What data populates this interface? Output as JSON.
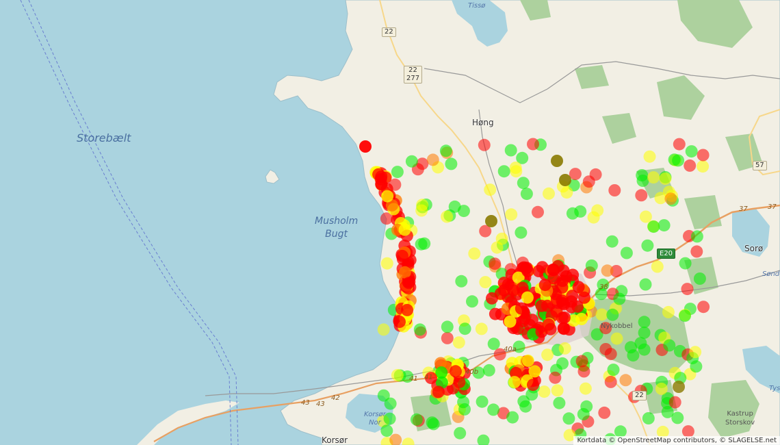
{
  "map": {
    "sea_label": "Storebælt",
    "bay_label_1": "Musholm",
    "bay_label_2": "Bugt",
    "towns": {
      "hong": "Høng",
      "soro": "Sorø",
      "korsor": "Korsør",
      "sonde": "Sønde",
      "tys": "Tys"
    },
    "water": {
      "tisso": "Tissø",
      "korsor_nor_1": "Korsør",
      "korsor_nor_2": "Nor"
    },
    "forests": {
      "nykobbel": "Nykobbel",
      "kastrup_1": "Kastrup",
      "kastrup_2": "Storskov"
    },
    "road_shields": {
      "r22_top": "22",
      "r22_mid": "22",
      "r277": "277",
      "r57": "57",
      "r22_south": "22"
    },
    "e_route": "E20",
    "road_numbers": {
      "n37a": "37",
      "n37b": "37",
      "n38": "38",
      "n40a": "40a",
      "n40b": "40a",
      "n40c": "40b",
      "n41": "41",
      "n41b": "41",
      "n42": "42",
      "n43a": "43",
      "n43b": "43"
    },
    "attribution": "Kortdata © OpenStreetMap contributors, © SLAGELSE.net"
  },
  "legend_colors": {
    "red": "#ff0000",
    "orange": "#ff7a00",
    "yellow": "#ffff00",
    "green": "#00ee00",
    "olive": "#8a7a00",
    "land": "#f2efe4",
    "water": "#aad3df",
    "forest": "#add19e"
  }
}
